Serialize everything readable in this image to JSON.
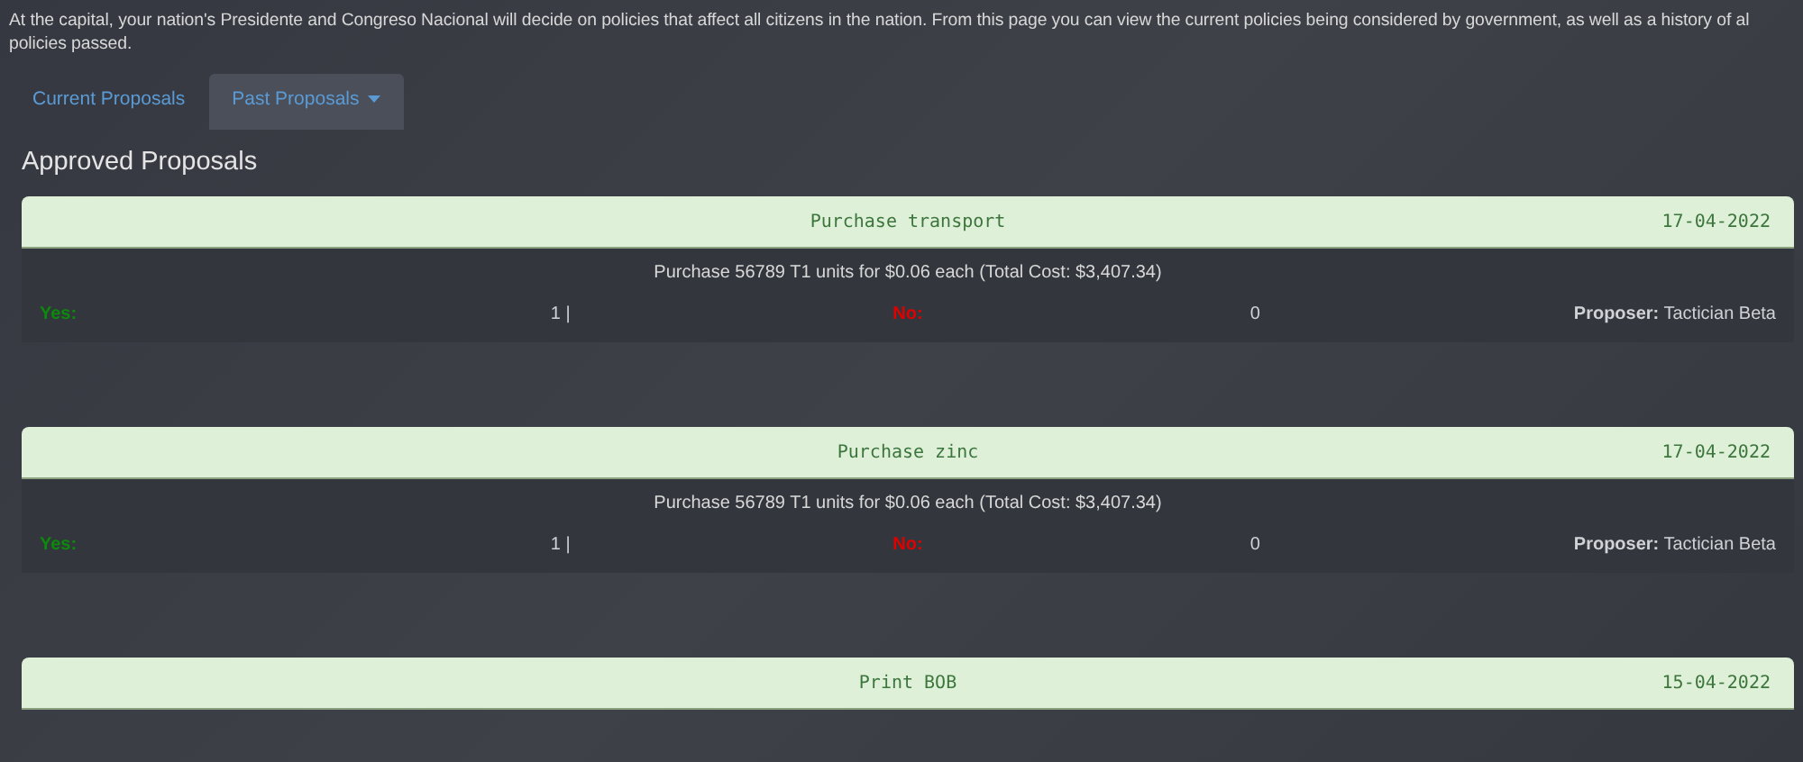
{
  "intro": "At the capital, your nation's Presidente and Congreso Nacional will decide on policies that affect all citizens in the nation. From this page you can view the current policies being considered by government, as well as a history of al\npolicies passed.",
  "tabs": [
    {
      "label": "Current Proposals",
      "selected": false,
      "dropdown": false
    },
    {
      "label": "Past Proposals",
      "selected": true,
      "dropdown": true
    }
  ],
  "heading": "Approved Proposals",
  "proposals": [
    {
      "title": "Purchase transport",
      "date": "17-04-2022",
      "description": "Purchase 56789 T1 units for $0.06 each (Total Cost: $3,407.34)",
      "yes_label": "Yes:",
      "yes_count": "1 |",
      "no_label": "No:",
      "no_count": "0",
      "proposer_label": "Proposer:",
      "proposer": "Tactician Beta"
    },
    {
      "title": "Purchase zinc",
      "date": "17-04-2022",
      "description": "Purchase 56789 T1 units for $0.06 each (Total Cost: $3,407.34)",
      "yes_label": "Yes:",
      "yes_count": "1 |",
      "no_label": "No:",
      "no_count": "0",
      "proposer_label": "Proposer:",
      "proposer": "Tactician Beta"
    },
    {
      "title": "Print BOB",
      "date": "15-04-2022"
    }
  ]
}
